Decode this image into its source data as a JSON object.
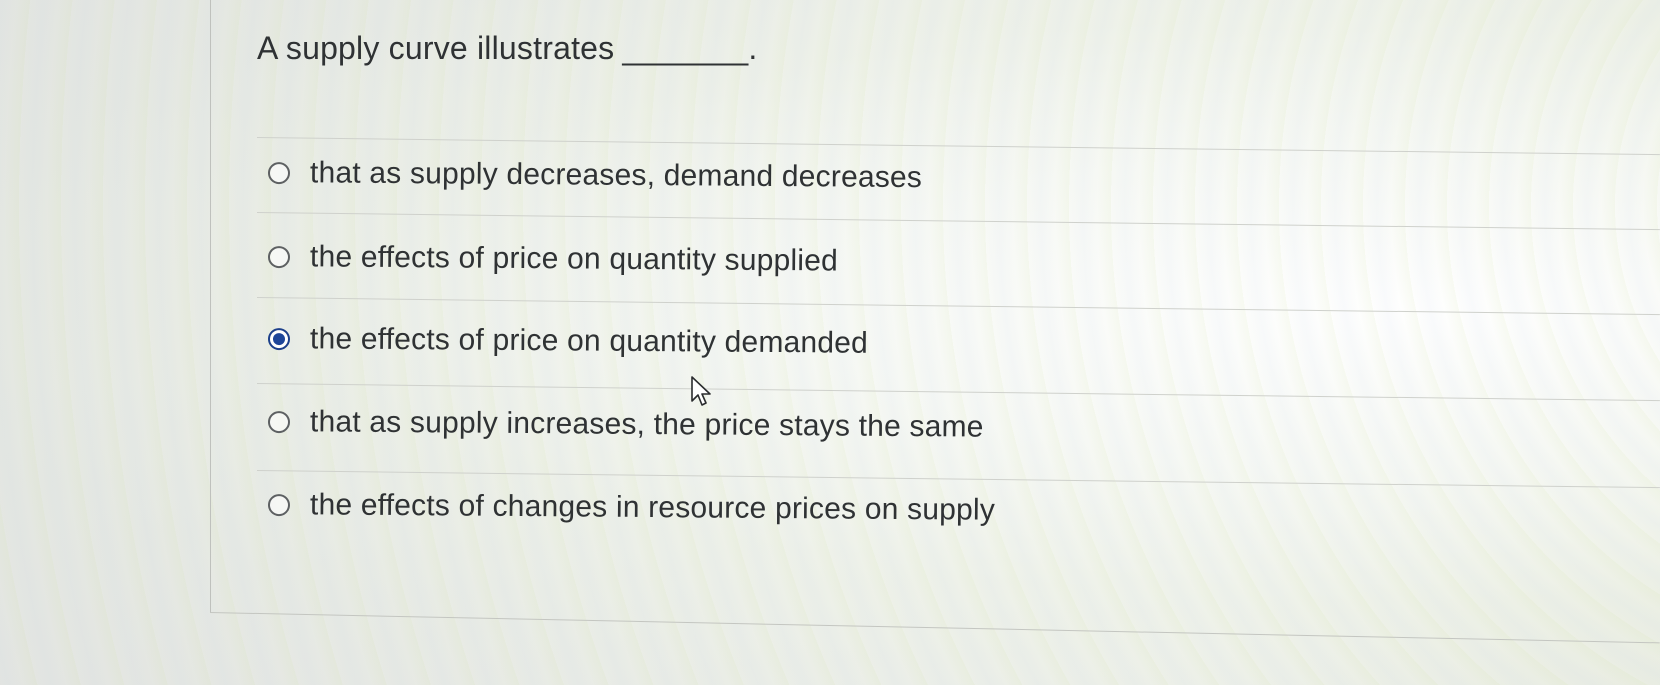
{
  "question": {
    "text": "A supply curve illustrates",
    "blank": "_______."
  },
  "options": [
    {
      "label": "that as supply decreases, demand decreases",
      "selected": false
    },
    {
      "label": "the effects of price on quantity supplied",
      "selected": false
    },
    {
      "label": "the effects of price on quantity demanded",
      "selected": true
    },
    {
      "label": "that as supply increases, the price stays the same",
      "selected": false
    },
    {
      "label": "the effects of changes in resource prices on supply",
      "selected": false
    }
  ],
  "colors": {
    "selected_radio": "#1d4599",
    "text": "#2f3234"
  },
  "icons": {
    "cursor": "arrow-pointer-icon"
  }
}
